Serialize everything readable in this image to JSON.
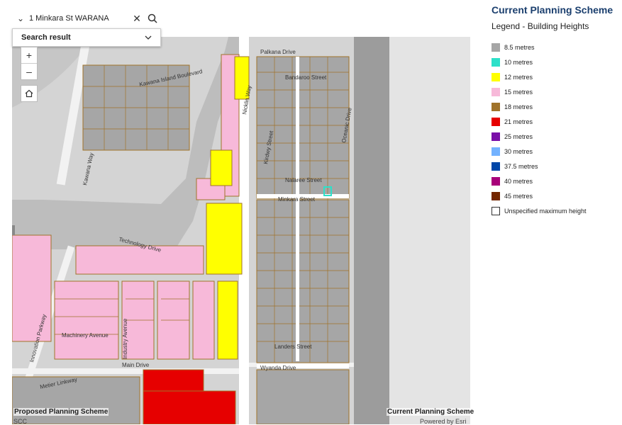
{
  "search": {
    "query": "1 Minkara St WARANA",
    "result_label": "Search result"
  },
  "map": {
    "left_label": "Proposed Planning Scheme",
    "right_label": "Current Planning Scheme",
    "attribution_left": "SCC",
    "attribution_right": "Powered by Esri",
    "street_labels": [
      "Palkana Drive",
      "Bandaroo Street",
      "Nicklin Way",
      "Kawana Island Boulevard",
      "Kawana Way",
      "Technology Drive",
      "Minkara Street",
      "Nalaree Street",
      "Machinery Avenue",
      "Industry Avenue",
      "Main Drive",
      "Wyanda Drive",
      "Metier Linkway",
      "Landers Street",
      "Oceanic Drive",
      "Kirdwy Street",
      "Innovation Parkway"
    ]
  },
  "legend": {
    "title": "Current Planning Scheme",
    "subtitle": "Legend - Building Heights",
    "items": [
      {
        "label": "8.5 metres",
        "color": "#a6a6a6"
      },
      {
        "label": "10 metres",
        "color": "#2de0c9"
      },
      {
        "label": "12 metres",
        "color": "#ffff00"
      },
      {
        "label": "15 metres",
        "color": "#f7b9d9"
      },
      {
        "label": "18 metres",
        "color": "#a0732a"
      },
      {
        "label": "21 metres",
        "color": "#e60000"
      },
      {
        "label": "25 metres",
        "color": "#7a0fa8"
      },
      {
        "label": "30 metres",
        "color": "#73b2ff"
      },
      {
        "label": "37.5 metres",
        "color": "#0046a8"
      },
      {
        "label": "40 metres",
        "color": "#a8007a"
      },
      {
        "label": "45 metres",
        "color": "#732600"
      },
      {
        "label": "Unspecified maximum height",
        "color": "#ffffff"
      }
    ]
  }
}
